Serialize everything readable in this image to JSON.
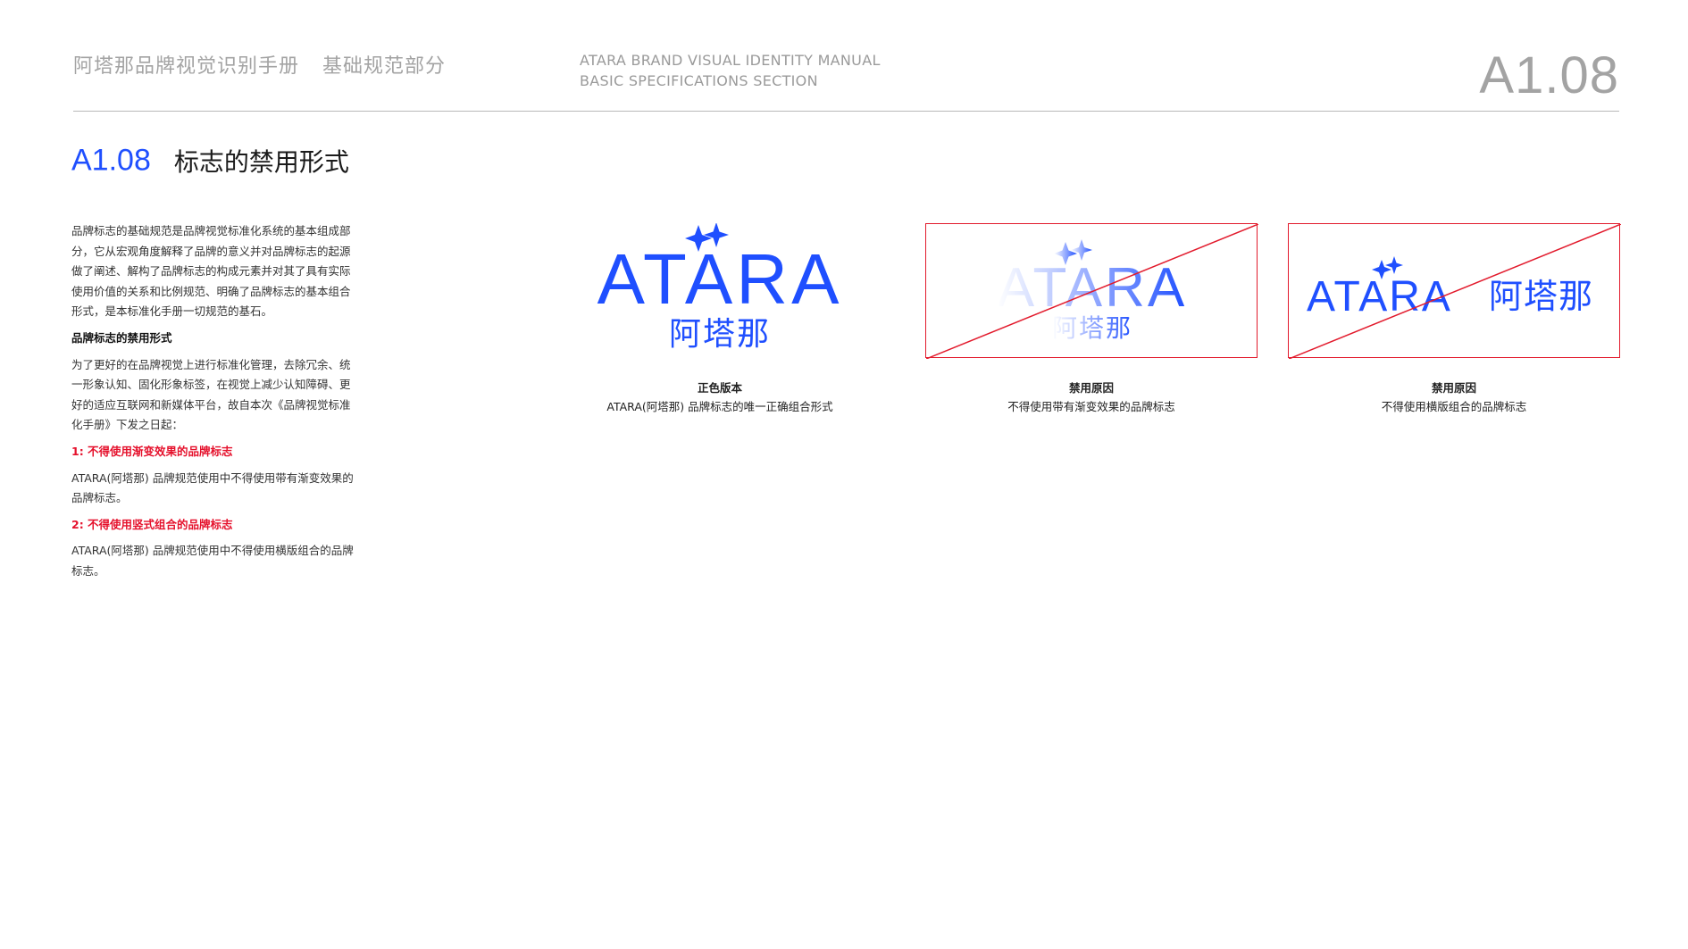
{
  "header": {
    "title_cn": "阿塔那品牌视觉识别手册",
    "section_cn": "基础规范部分",
    "title_en": "ATARA BRAND VISUAL IDENTITY MANUAL",
    "section_en": "BASIC SPECIFICATIONS SECTION",
    "page_number": "A1.08"
  },
  "title": {
    "number": "A1.08",
    "text": "标志的禁用形式"
  },
  "body": {
    "intro": "品牌标志的基础规范是品牌视觉标准化系统的基本组成部分，它从宏观角度解释了品牌的意义并对品牌标志的起源做了阐述、解构了品牌标志的构成元素并对其了具有实际使用价值的关系和比例规范、明确了品牌标志的基本组合形式，是本标准化手册一切规范的基石。",
    "subheading": "品牌标志的禁用形式",
    "para": "为了更好的在品牌视觉上进行标准化管理，去除冗余、统一形象认知、固化形象标签，在视觉上减少认知障碍、更好的适应互联网和新媒体平台，故自本次《品牌视觉标准化手册》下发之日起：",
    "rule1_title": "1: 不得使用渐变效果的品牌标志",
    "rule1_text": "ATARA(阿塔那) 品牌规范使用中不得使用带有渐变效果的品牌标志。",
    "rule2_title": "2: 不得使用竖式组合的品牌标志",
    "rule2_text": "ATARA(阿塔那) 品牌规范使用中不得使用横版组合的品牌标志。"
  },
  "logo": {
    "wordmark": "ATARA",
    "chinese": "阿塔那"
  },
  "colors": {
    "brand_blue": "#1f4fff",
    "forbidden_red": "#e21a2c",
    "header_gray": "#a3a3a3"
  },
  "examples": [
    {
      "caption_title": "正色版本",
      "caption_text": "ATARA(阿塔那) 品牌标志的唯一正确组合形式"
    },
    {
      "caption_title": "禁用原因",
      "caption_text": "不得使用带有渐变效果的品牌标志"
    },
    {
      "caption_title": "禁用原因",
      "caption_text": "不得使用横版组合的品牌标志"
    }
  ]
}
